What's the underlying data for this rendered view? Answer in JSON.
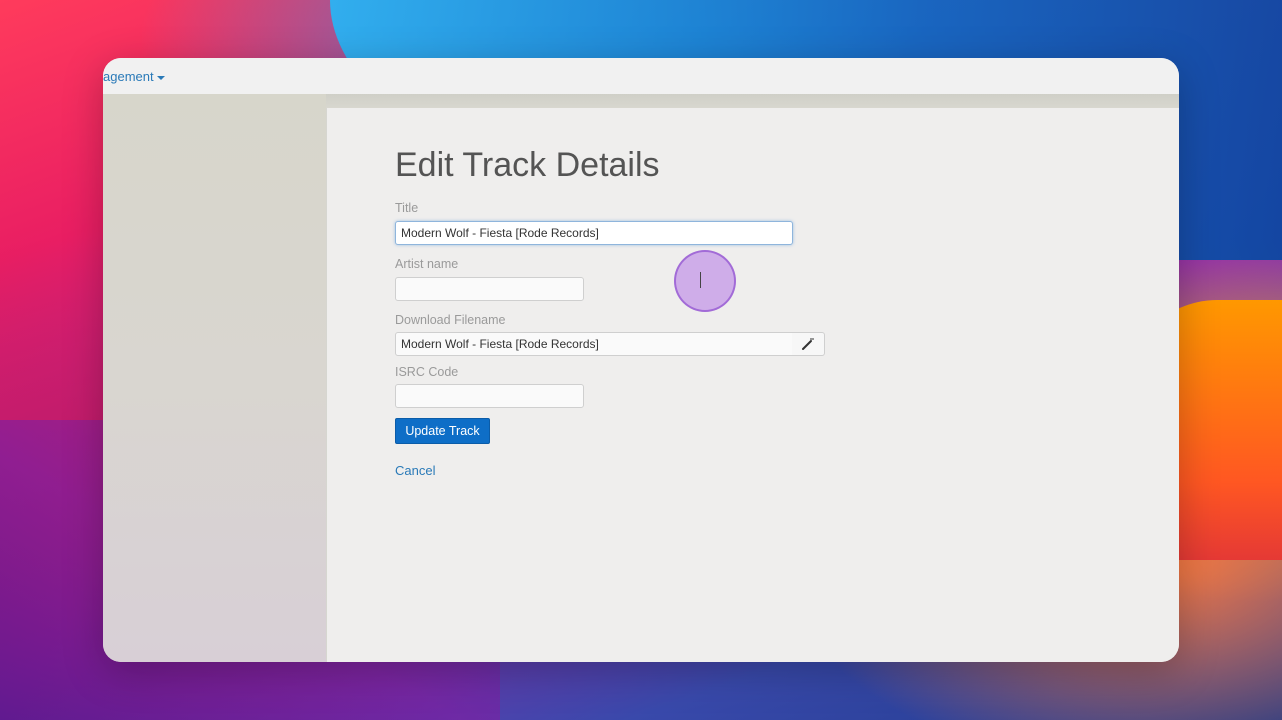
{
  "nav": {
    "menu_label": "agement"
  },
  "page": {
    "title": "Edit Track Details"
  },
  "form": {
    "title_label": "Title",
    "title_value": "Modern Wolf - Fiesta [Rode Records]",
    "artist_label": "Artist name",
    "artist_value": "",
    "filename_label": "Download Filename",
    "filename_value": "Modern Wolf - Fiesta [Rode Records]",
    "isrc_label": "ISRC Code",
    "isrc_value": "",
    "submit_label": "Update Track",
    "cancel_label": "Cancel"
  },
  "icons": {
    "filename_action": "magic-wand-icon",
    "pointer": "text-cursor-icon"
  },
  "colors": {
    "primary": "#0e6ec7",
    "link": "#2a7ab8",
    "cursor_highlight": "#b478e6"
  }
}
